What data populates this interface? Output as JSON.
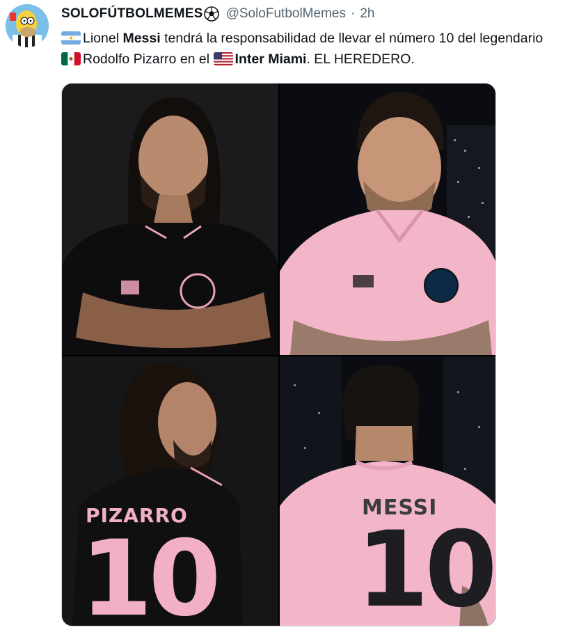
{
  "tweet": {
    "display_name": "SOLOFÚTBOLMEMES",
    "handle": "@SoloFutbolMemes",
    "separator": "·",
    "time": "2h",
    "text": {
      "t1": "Lionel ",
      "t2": "Messi",
      "t3": " tendrá la responsabilidad de llevar el número 10 del legendario ",
      "t4": "Rodolfo Pizarro en el ",
      "t5": "Inter Miami",
      "t6": ". EL HEREDERO."
    }
  },
  "icons": {
    "avatar": "homer-avatar",
    "name_emoji": "soccer-ball-icon",
    "flags": [
      "argentina-flag-icon",
      "mexico-flag-icon",
      "usa-flag-icon"
    ]
  },
  "media": {
    "photo3": {
      "jersey_name": "PIZARRO",
      "jersey_number": "10"
    },
    "photo4": {
      "jersey_name": "MESSI",
      "jersey_number": "10"
    }
  },
  "colors": {
    "text": "#0f1419",
    "secondary_text": "#536471",
    "border": "#cfd9de",
    "pink_kit": "#f3b6c9",
    "black_kit": "#111111"
  }
}
